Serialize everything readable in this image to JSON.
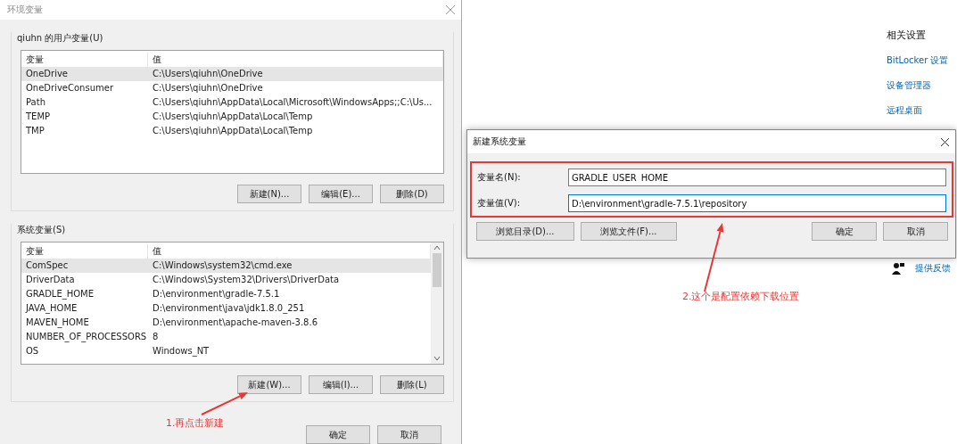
{
  "env_dialog": {
    "title": "环境变量",
    "user_vars": {
      "label": "qiuhn 的用户变量(U)",
      "columns": [
        "变量",
        "值"
      ],
      "scrollbar": false,
      "rows": [
        {
          "name": "OneDrive",
          "value": "C:\\Users\\qiuhn\\OneDrive",
          "selected": true
        },
        {
          "name": "OneDriveConsumer",
          "value": "C:\\Users\\qiuhn\\OneDrive",
          "selected": false
        },
        {
          "name": "Path",
          "value": "C:\\Users\\qiuhn\\AppData\\Local\\Microsoft\\WindowsApps;;C:\\Us...",
          "selected": false
        },
        {
          "name": "TEMP",
          "value": "C:\\Users\\qiuhn\\AppData\\Local\\Temp",
          "selected": false
        },
        {
          "name": "TMP",
          "value": "C:\\Users\\qiuhn\\AppData\\Local\\Temp",
          "selected": false
        }
      ],
      "buttons": [
        "新建(N)...",
        "编辑(E)...",
        "删除(D)"
      ]
    },
    "system_vars": {
      "label": "系统变量(S)",
      "columns": [
        "变量",
        "值"
      ],
      "scrollbar": true,
      "rows": [
        {
          "name": "ComSpec",
          "value": "C:\\Windows\\system32\\cmd.exe",
          "selected": true
        },
        {
          "name": "DriverData",
          "value": "C:\\Windows\\System32\\Drivers\\DriverData",
          "selected": false
        },
        {
          "name": "GRADLE_HOME",
          "value": "D:\\environment\\gradle-7.5.1",
          "selected": false
        },
        {
          "name": "JAVA_HOME",
          "value": "D:\\environment\\java\\jdk1.8.0_251",
          "selected": false
        },
        {
          "name": "MAVEN_HOME",
          "value": "D:\\environment\\apache-maven-3.8.6",
          "selected": false
        },
        {
          "name": "NUMBER_OF_PROCESSORS",
          "value": "8",
          "selected": false
        },
        {
          "name": "OS",
          "value": "Windows_NT",
          "selected": false
        }
      ],
      "buttons": [
        "新建(W)...",
        "编辑(I)...",
        "删除(L)"
      ]
    },
    "buttons": [
      "确定",
      "取消"
    ]
  },
  "settings_page": {
    "heading": "相关设置",
    "links": [
      "BitLocker 设置",
      "设备管理器",
      "远程桌面"
    ],
    "feedback": "提供反馈"
  },
  "new_var_dialog": {
    "title": "新建系统变量",
    "fields": [
      {
        "label": "变量名(N):",
        "value": "GRADLE_USER_HOME",
        "focused": false
      },
      {
        "label": "变量值(V):",
        "value": "D:\\environment\\gradle-7.5.1\\repository",
        "focused": true
      }
    ],
    "left_buttons": [
      "浏览目录(D)...",
      "浏览文件(F)..."
    ],
    "right_buttons": [
      "确定",
      "取消"
    ]
  },
  "annotations": [
    "1.再点击新建",
    "2.这个是配置依赖下载位置"
  ]
}
